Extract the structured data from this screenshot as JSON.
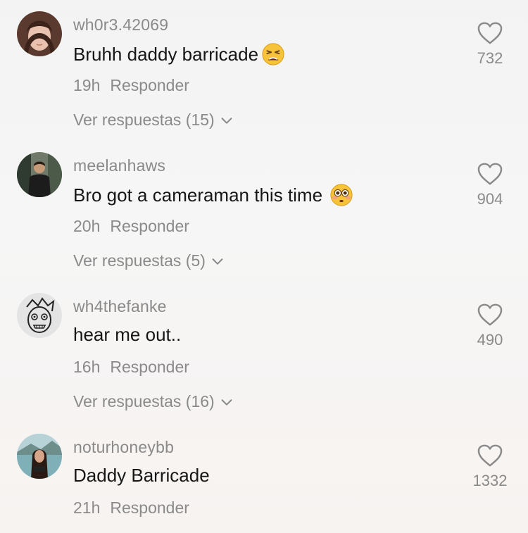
{
  "colors": {
    "background": "#f5f5f5",
    "username": "#8a8a8a",
    "text": "#161616",
    "meta": "#8a8a8a"
  },
  "comments": [
    {
      "username": "wh0r3.42069",
      "text": "Bruhh daddy barricade",
      "emoji": "tired-face-emoji",
      "time": "19h",
      "reply_label": "Responder",
      "view_replies": "Ver respuestas (15)",
      "likes": "732"
    },
    {
      "username": "meelanhaws",
      "text": "Bro got a cameraman this time",
      "emoji": "flushed-face-emoji",
      "time": "20h",
      "reply_label": "Responder",
      "view_replies": "Ver respuestas (5)",
      "likes": "904"
    },
    {
      "username": "wh4thefanke",
      "text": "hear me out..",
      "time": "16h",
      "reply_label": "Responder",
      "view_replies": "Ver respuestas (16)",
      "likes": "490"
    },
    {
      "username": "noturhoneybb",
      "text": "Daddy Barricade",
      "time": "21h",
      "reply_label": "Responder",
      "likes": "1332"
    }
  ]
}
